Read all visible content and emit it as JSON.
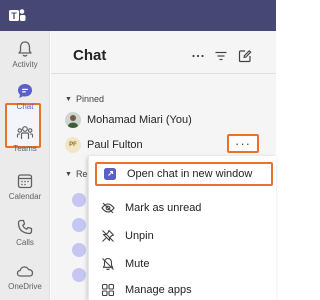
{
  "main": {
    "title": "Chat"
  },
  "rail": {
    "items": [
      {
        "label": "Activity",
        "icon": "bell-icon"
      },
      {
        "label": "Chat",
        "icon": "chat-icon",
        "active": true
      },
      {
        "label": "Teams",
        "icon": "teams-icon"
      },
      {
        "label": "Calendar",
        "icon": "calendar-icon"
      },
      {
        "label": "Calls",
        "icon": "phone-icon"
      },
      {
        "label": "OneDrive",
        "icon": "cloud-icon"
      }
    ]
  },
  "sections": {
    "pinned": "Pinned",
    "recent": "Rec"
  },
  "chats": {
    "pinned": [
      {
        "name": "Mohamad Miari (You)"
      },
      {
        "name": "Paul Fulton",
        "initials": "PF"
      }
    ]
  },
  "context_menu": {
    "items": [
      {
        "label": "Open chat in new window",
        "icon": "open-window-icon"
      },
      {
        "label": "Mark as unread",
        "icon": "eye-unread-icon"
      },
      {
        "label": "Unpin",
        "icon": "unpin-icon"
      },
      {
        "label": "Mute",
        "icon": "mute-bell-icon"
      },
      {
        "label": "Manage apps",
        "icon": "apps-grid-icon"
      }
    ]
  },
  "more_button": {
    "label": "···"
  },
  "colors": {
    "titlebar": "#464775",
    "accent": "#5b5fc7",
    "highlight": "#e8722c"
  }
}
